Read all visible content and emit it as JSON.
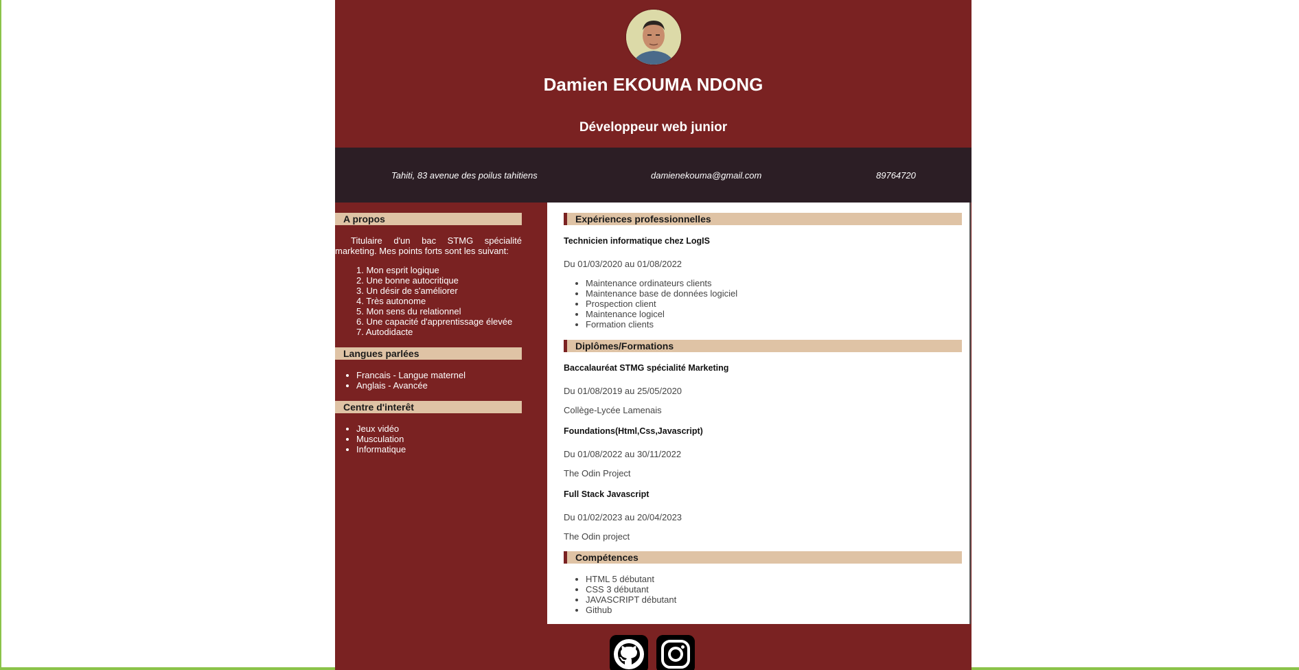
{
  "header": {
    "name": "Damien EKOUMA NDONG",
    "role": "Développeur web junior"
  },
  "contact": {
    "address": "Tahiti, 83 avenue des poilus tahitiens",
    "email": "damienekouma@gmail.com",
    "phone": "89764720"
  },
  "sidebar": {
    "about_title": "A propos",
    "about_text": "Titulaire d'un bac STMG spécialité marketing. Mes points forts sont les suivant:",
    "strengths": [
      "1. Mon esprit logique",
      "2. Une bonne autocritique",
      "3. Un désir de s'améliorer",
      "4. Très autonome",
      "5. Mon sens du relationnel",
      "6. Une capacité d'apprentissage élevée",
      "7. Autodidacte"
    ],
    "languages_title": "Langues parlées",
    "languages": [
      "Francais - Langue maternel",
      "Anglais - Avancée"
    ],
    "interests_title": "Centre d'interêt",
    "interests": [
      "Jeux vidéo",
      "Musculation",
      "Informatique"
    ]
  },
  "main": {
    "experience_title": "Expériences professionnelles",
    "job": {
      "title": "Technicien informatique chez LogIS",
      "dates": "Du 01/03/2020 au 01/08/2022",
      "tasks": [
        "Maintenance ordinateurs clients",
        "Maintenance base de données logiciel",
        "Prospection client",
        "Maintenance logicel",
        "Formation clients"
      ]
    },
    "education_title": "Diplômes/Formations",
    "education": [
      {
        "title": "Baccalauréat STMG spécialité Marketing",
        "dates": "Du 01/08/2019 au 25/05/2020",
        "school": "Collège-Lycée Lamenais"
      },
      {
        "title": "Foundations(Html,Css,Javascript)",
        "dates": "Du 01/08/2022 au 30/11/2022",
        "school": "The Odin Project"
      },
      {
        "title": "Full Stack Javascript",
        "dates": "Du 01/02/2023 au 20/04/2023",
        "school": "The Odin project"
      }
    ],
    "skills_title": "Compétences",
    "skills": [
      "HTML 5 débutant",
      "CSS 3 débutant",
      "JAVASCRIPT débutant",
      "Github"
    ]
  },
  "footer": {
    "icons": [
      "github-icon",
      "instagram-icon"
    ]
  },
  "colors": {
    "primary": "#7a2222",
    "dark_bar": "#2c1e25",
    "section_bg": "#dfc3a5",
    "frame": "#8bc34a"
  }
}
